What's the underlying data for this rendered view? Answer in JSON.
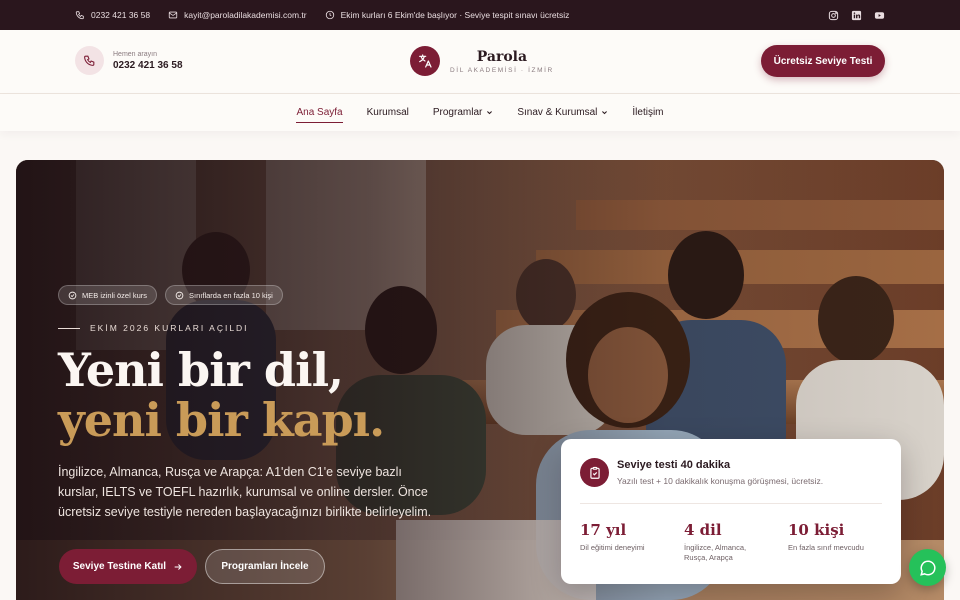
{
  "topbar": {
    "phone": "0232 421 36 58",
    "email": "kayit@paroladilakademisi.com.tr",
    "announcement": "Ekim kurları 6 Ekim'de başlıyor · Seviye tespit sınavı ücretsiz",
    "socials": [
      "instagram-icon",
      "linkedin-icon",
      "youtube-icon"
    ]
  },
  "header": {
    "call_caption": "Hemen arayın",
    "call_number": "0232 421 36 58",
    "brand_name": "Parola",
    "brand_sub": "DİL AKADEMİSİ · İZMİR",
    "cta_label": "Ücretsiz Seviye Testi"
  },
  "nav": {
    "items": [
      {
        "label": "Ana Sayfa",
        "active": true
      },
      {
        "label": "Kurumsal"
      },
      {
        "label": "Programlar",
        "dropdown": true
      },
      {
        "label": "Sınav & Kurumsal",
        "dropdown": true
      },
      {
        "label": "İletişim"
      }
    ]
  },
  "hero": {
    "badges": [
      "MEB izinli özel kurs",
      "Sınıflarda en fazla 10 kişi"
    ],
    "kicker": "EKİM 2026 KURLARI AÇILDI",
    "title_line1": "Yeni bir dil,",
    "title_line2": "yeni bir kapı.",
    "lead": "İngilizce, Almanca, Rusça ve Arapça: A1'den C1'e seviye bazlı kurslar, IELTS ve TOEFL hazırlık, kurumsal ve online dersler. Önce ücretsiz seviye testiyle nereden başlayacağınızı birlikte belirleyelim.",
    "primary_cta": "Seviye Testine Katıl",
    "secondary_cta": "Programları İncele"
  },
  "card": {
    "title": "Seviye testi 40 dakika",
    "subtitle": "Yazılı test + 10 dakikalık konuşma görüşmesi, ücretsiz.",
    "stats": [
      {
        "value": "17 yıl",
        "label": "Dil eğitimi deneyimi"
      },
      {
        "value": "4 dil",
        "label": "İngilizce, Almanca, Rusça, Arapça"
      },
      {
        "value": "10 kişi",
        "label": "En fazla sınıf mevcudu"
      }
    ]
  },
  "colors": {
    "brand": "#7c1d35",
    "accent_gold": "#c99b58",
    "topbar": "#2a161d",
    "chat": "#25c15a"
  }
}
